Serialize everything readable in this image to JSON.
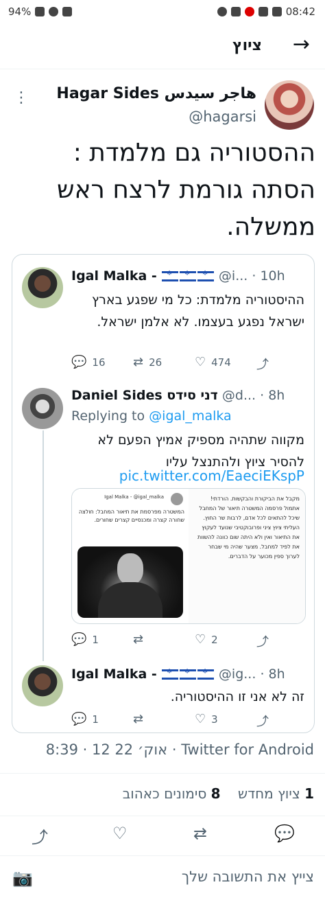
{
  "status_bar": {
    "battery": "94%",
    "time": "08:42"
  },
  "header": {
    "title": "ציוץ",
    "back_icon": "arrow-right-icon"
  },
  "tweet": {
    "author_name": "Hagar Sides هاجر سيدس",
    "handle": "@hagarsi",
    "text": "ההסטוריה גם מלמדת : הסתה גורמת לרצח ראש ממשלה.",
    "timestamp": "8:39 · 12 אוק׳ 22 · Twitter for Android",
    "retweets_count": "1",
    "retweets_label": "ציוץ מחדש",
    "likes_count": "8",
    "likes_label": "סימונים כאהוב"
  },
  "thread": [
    {
      "name": "Igal Malka -",
      "handle": "@i...",
      "time": "· 10h",
      "text": "ההיסטוריה מלמדת: כל מי שפגע בארץ ישראל נפגע בעצמו. לא אלמן ישראל.",
      "reply_count": "16",
      "retweet_count": "26",
      "like_count": "474"
    },
    {
      "name": "Daniel Sides דני סידס",
      "handle": "@d...",
      "time": "· 8h",
      "replying_label": "Replying to",
      "replying_to": "@igal_malka",
      "text": "מקווה שתהיה מספיק אמיץ הפעם לא להסיר ציוץ ולהתנצל עליו",
      "link": "pic.twitter.com/EaeciEKspP",
      "media_left_name": "Igal Malka -",
      "media_left_handle": "@igal_malka",
      "media_left_text": "המשטרה מפרסמת את תיאור המחבל: חולצה שחורה קצרה ומכנסיים קצרים שחורים.",
      "media_right_text": "מקבל את הביקורת והבקשות. הורדתי! אתמול פרסמה המשטרה תיאור של המחבל שיכל להתאים לכל אדם, לרבות שר החוץ. העליתי ציוץ ציני ופרובוקטיבי שנועד לעקוץ את התיאור ואין ולא היתה שום כוונה להשוות את לפיד למחבל. מצער שהיה מי שבחר לערוך ספין מכוער על הדברים.",
      "reply_count": "1",
      "retweet_count": "",
      "like_count": "2"
    },
    {
      "name": "Igal Malka -",
      "handle": "@ig...",
      "time": "· 8h",
      "text": "זה לא אני זו ההיסטוריה.",
      "reply_count": "1",
      "retweet_count": "",
      "like_count": "3"
    }
  ],
  "reply_bar": {
    "placeholder": "צייץ את התשובה שלך"
  },
  "colors": {
    "accent": "#1d9bf0",
    "text": "#0f1419",
    "secondary": "#536471"
  }
}
